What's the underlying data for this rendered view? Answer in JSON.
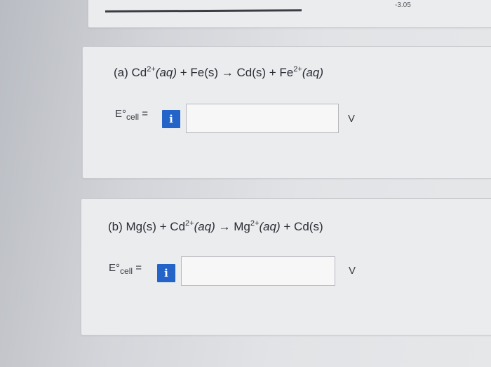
{
  "top": {
    "value": "-3.05"
  },
  "part_a": {
    "equation": {
      "prefix": "(a) Cd",
      "charge1": "2+",
      "phase1": "(aq)",
      "mid": " + Fe(s) → Cd(s) + Fe",
      "charge2": "2+",
      "phase2": "(aq)"
    },
    "label": {
      "main": "E°",
      "sub": "cell",
      "equals": " ="
    },
    "info_label": "i",
    "input_value": "",
    "unit": "V"
  },
  "part_b": {
    "equation": {
      "prefix": "(b) Mg(s) + Cd",
      "charge1": "2+",
      "phase1": "(aq)",
      "mid": " → Mg",
      "charge2": "2+",
      "phase2": "(aq)",
      "suffix": " + Cd(s)"
    },
    "label": {
      "main": "E°",
      "sub": "cell",
      "equals": " ="
    },
    "info_label": "i",
    "input_value": "",
    "unit": "V"
  }
}
